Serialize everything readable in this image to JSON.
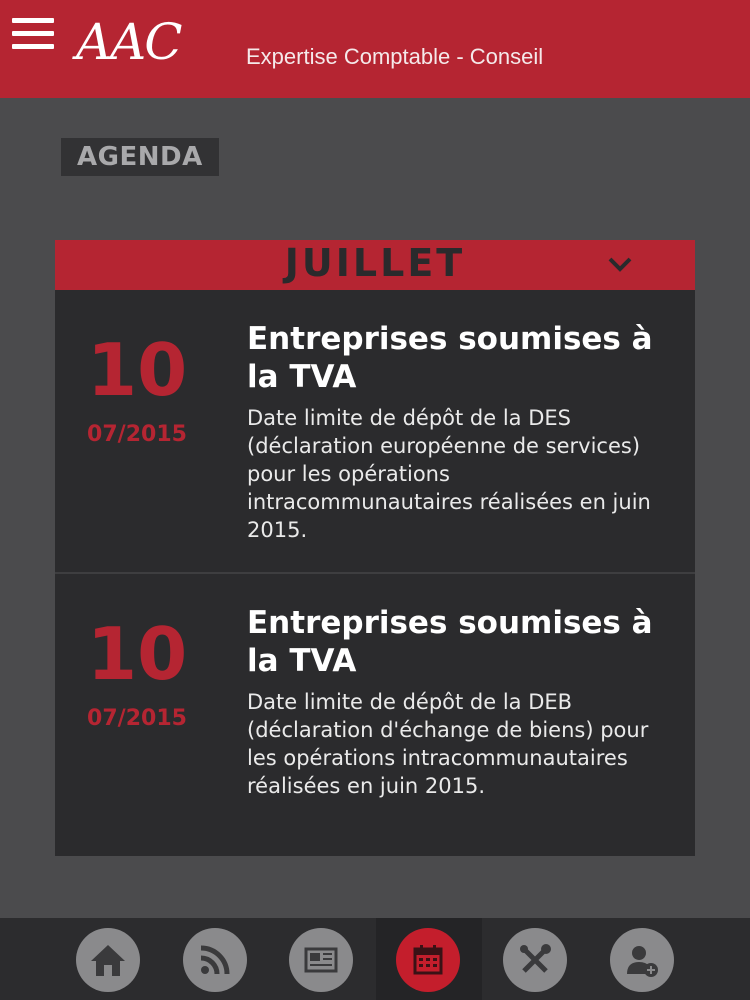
{
  "header": {
    "logo_text": "AAC",
    "tagline": "Expertise Comptable - Conseil"
  },
  "section": {
    "title": "AGENDA"
  },
  "month": {
    "label": "JUILLET"
  },
  "events": [
    {
      "day": "10",
      "date": "07/2015",
      "title": "Entreprises soumises à la TVA",
      "description": "Date limite de dépôt de la DES (déclaration européenne de services) pour les opérations intracommunautaires réalisées en juin 2015."
    },
    {
      "day": "10",
      "date": "07/2015",
      "title": "Entreprises soumises à la TVA",
      "description": "Date limite de dépôt de la DEB (déclaration d'échange de biens) pour les opérations intracommunautaires réalisées en juin 2015."
    }
  ],
  "nav": {
    "items": [
      {
        "icon": "home-icon"
      },
      {
        "icon": "rss-icon"
      },
      {
        "icon": "newspaper-icon"
      },
      {
        "icon": "calendar-icon",
        "active": true
      },
      {
        "icon": "tools-icon"
      },
      {
        "icon": "user-add-icon"
      }
    ]
  },
  "colors": {
    "brand_red": "#b52532",
    "background": "#4b4b4d",
    "card": "#2b2b2d"
  }
}
